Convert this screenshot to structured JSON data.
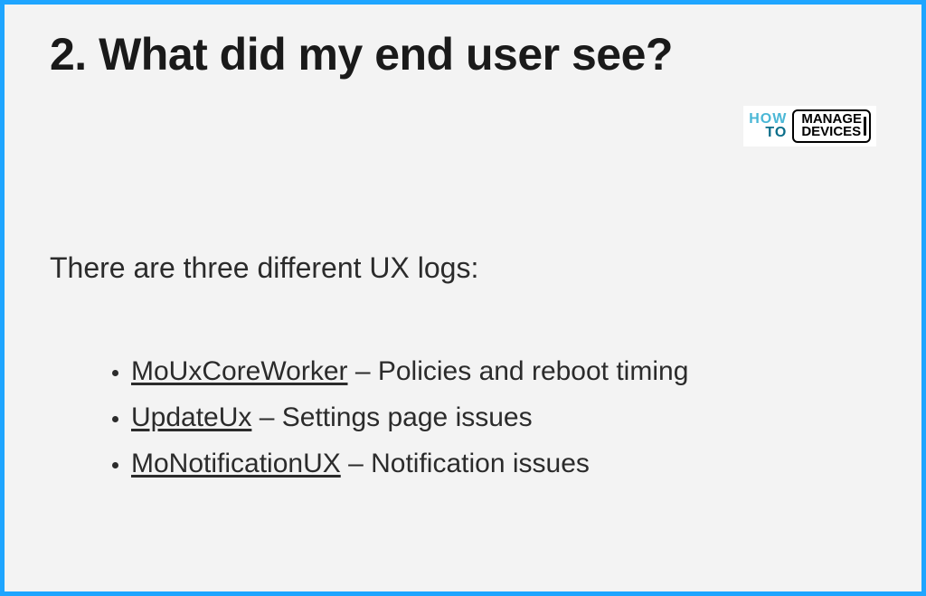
{
  "title": "2. What did my end user see?",
  "logo": {
    "left_top": "HOW",
    "left_bottom": "TO",
    "right_top": "MANAGE",
    "right_bottom": "DEVICES"
  },
  "intro": "There are three different UX logs:",
  "items": [
    {
      "name": "MoUxCoreWorker",
      "desc": " – Policies and reboot timing"
    },
    {
      "name": "UpdateUx",
      "desc": " – Settings page issues"
    },
    {
      "name": "MoNotificationUX",
      "desc": " – Notification issues"
    }
  ]
}
